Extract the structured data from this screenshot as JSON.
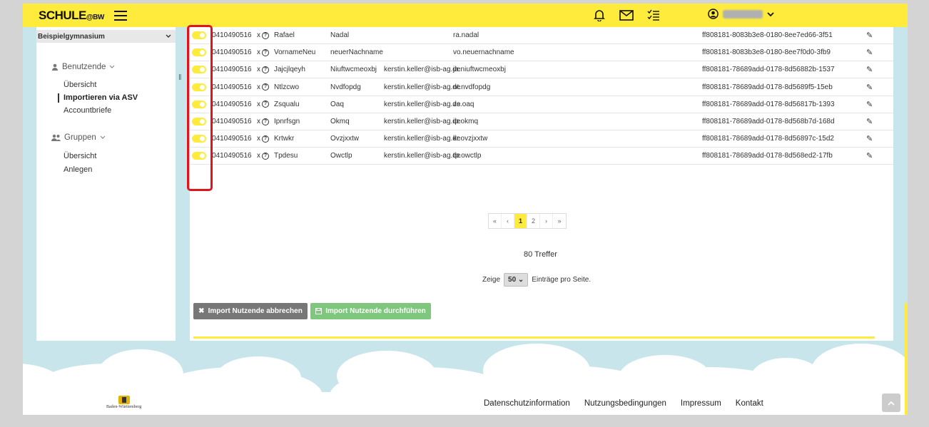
{
  "header": {
    "logo_main": "SCHULE",
    "logo_suffix": "@BW",
    "icons": [
      "bell-icon",
      "mail-icon",
      "tasks-icon",
      "user-circle-icon",
      "chevron-down-icon"
    ],
    "user_name": "Org-Admin"
  },
  "sidebar": {
    "school": "Beispielgymnasium",
    "groups": [
      {
        "label": "Benutzende",
        "icon": "user-icon",
        "items": [
          "Übersicht",
          "Importieren via ASV",
          "Accountbriefe"
        ]
      },
      {
        "label": "Gruppen",
        "icon": "users-icon",
        "items": [
          "Übersicht",
          "Anlegen"
        ]
      }
    ],
    "active_item": "Importieren via ASV"
  },
  "table": {
    "rows": [
      {
        "id": "0410490516",
        "x": "x",
        "first": "Rafael",
        "last": "Nadal",
        "mail": "",
        "login": "ra.nadal",
        "uuid": "ff808181-8083b3e8-0180-8ee7ed66-3f51"
      },
      {
        "id": "0410490516",
        "x": "x",
        "first": "VornameNeu",
        "last": "neuerNachname",
        "mail": "",
        "login": "vo.neuernachname",
        "uuid": "ff808181-8083b3e8-0180-8ee7f0d0-3fb9"
      },
      {
        "id": "0410490516",
        "x": "x",
        "first": "Jajcjlqeyh",
        "last": "Niuftwcmeoxbj",
        "mail": "kerstin.keller@isb-ag.de",
        "login": "ja.niuftwcmeoxbj",
        "uuid": "ff808181-78689add-0178-8d56882b-1537"
      },
      {
        "id": "0410490516",
        "x": "x",
        "first": "Ntlzcwo",
        "last": "Nvdfopdg",
        "mail": "kerstin.keller@isb-ag.de",
        "login": "nt.nvdfopdg",
        "uuid": "ff808181-78689add-0178-8d5689f5-15eb"
      },
      {
        "id": "0410490516",
        "x": "x",
        "first": "Zsqualu",
        "last": "Oaq",
        "mail": "kerstin.keller@isb-ag.de",
        "login": "zs.oaq",
        "uuid": "ff808181-78689add-0178-8d56817b-1393"
      },
      {
        "id": "0410490516",
        "x": "x",
        "first": "Ipnrfsgn",
        "last": "Okmq",
        "mail": "kerstin.keller@isb-ag.de",
        "login": "ip.okmq",
        "uuid": "ff808181-78689add-0178-8d568b7d-168d"
      },
      {
        "id": "0410490516",
        "x": "x",
        "first": "Krtwkr",
        "last": "Ovzjxxtw",
        "mail": "kerstin.keller@isb-ag.de",
        "login": "kr.ovzjxxtw",
        "uuid": "ff808181-78689add-0178-8d56897c-15d2"
      },
      {
        "id": "0410490516",
        "x": "x",
        "first": "Tpdesu",
        "last": "Owctlp",
        "mail": "kerstin.keller@isb-ag.de",
        "login": "tp.owctlp",
        "uuid": "ff808181-78689add-0178-8d568ed2-17fb"
      }
    ]
  },
  "pagination": {
    "first": "«",
    "prev": "‹",
    "pages": [
      "1",
      "2"
    ],
    "current": "1",
    "next": "›",
    "last": "»"
  },
  "hits": "80 Treffer",
  "per_page": {
    "prefix": "Zeige",
    "value": "50",
    "suffix": "Einträge pro Seite."
  },
  "buttons": {
    "cancel": "Import Nutzende abbrechen",
    "run": "Import Nutzende durchführen"
  },
  "footer": {
    "crest_text": "Baden-Württemberg",
    "links": [
      "Datenschutzinformation",
      "Nutzungsbedingungen",
      "Impressum",
      "Kontakt"
    ]
  },
  "colors": {
    "accent": "#ffeb3b",
    "success": "#7ec87e",
    "neutral_button": "#777777",
    "highlight": "#e0141c"
  }
}
